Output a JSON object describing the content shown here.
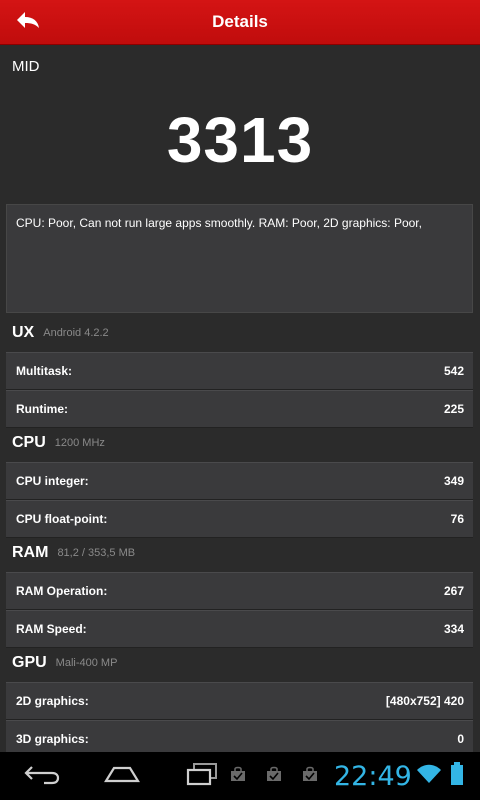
{
  "header": {
    "title": "Details",
    "back_icon": "back-arrow-icon"
  },
  "device": {
    "name": "MID",
    "score": "3313"
  },
  "summary": "CPU: Poor, Can not run large apps smoothly. RAM: Poor, 2D graphics: Poor,",
  "sections": [
    {
      "title": "UX",
      "subtitle": "Android 4.2.2",
      "rows": [
        {
          "label": "Multitask:",
          "value": "542"
        },
        {
          "label": "Runtime:",
          "value": "225"
        }
      ]
    },
    {
      "title": "CPU",
      "subtitle": "1200 MHz",
      "rows": [
        {
          "label": "CPU integer:",
          "value": "349"
        },
        {
          "label": "CPU float-point:",
          "value": "76"
        }
      ]
    },
    {
      "title": "RAM",
      "subtitle": "81,2 / 353,5 MB",
      "rows": [
        {
          "label": "RAM Operation:",
          "value": "267"
        },
        {
          "label": "RAM Speed:",
          "value": "334"
        }
      ]
    },
    {
      "title": "GPU",
      "subtitle": "Mali-400 MP",
      "rows": [
        {
          "label": "2D graphics:",
          "value": "[480x752] 420"
        },
        {
          "label": "3D graphics:",
          "value": "0"
        }
      ]
    }
  ],
  "navbar": {
    "time": "22:49",
    "clock_color": "#33b5e5",
    "icons": [
      "back-icon",
      "home-icon",
      "recent-apps-icon",
      "shopping-bag-icon",
      "shopping-bag-icon",
      "shopping-bag-icon",
      "wifi-icon",
      "battery-icon"
    ]
  },
  "colors": {
    "header_red": "#c8100f",
    "background": "#2b2b2b",
    "row_background": "#3a3a3c"
  }
}
